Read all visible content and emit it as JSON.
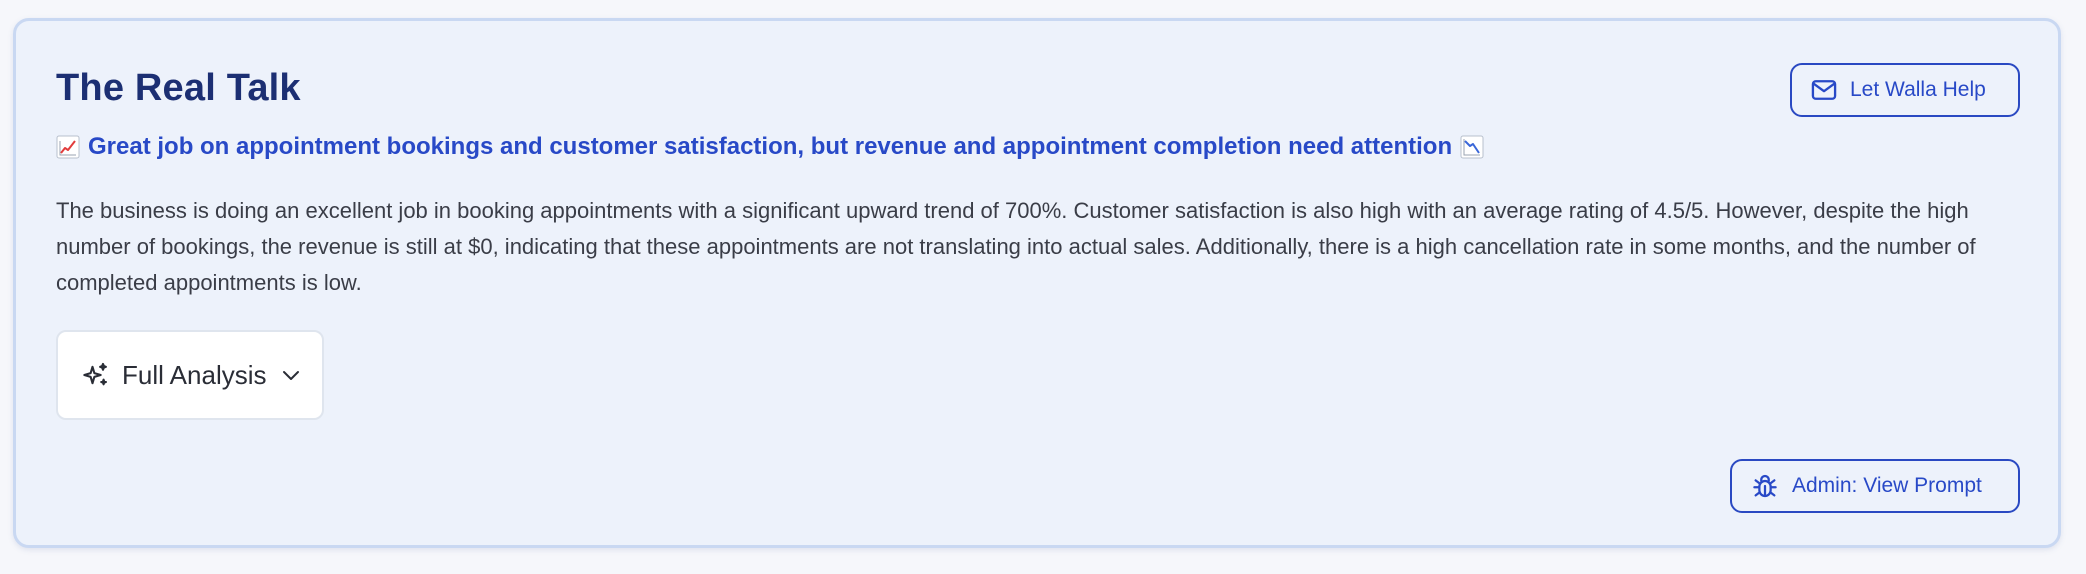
{
  "card": {
    "title": "The Real Talk",
    "headline": "Great job on appointment bookings and customer satisfaction, but revenue and appointment completion need attention",
    "headline_icon_left": "chart-increasing-icon",
    "headline_icon_right": "chart-decreasing-icon",
    "body": "The business is doing an excellent job in booking appointments with a significant upward trend of 700%. Customer satisfaction is also high with an average rating of 4.5/5. However, despite the high number of bookings, the revenue is still at $0, indicating that these appointments are not translating into actual sales. Additionally, there is a high cancellation rate in some months, and the number of completed appointments is low."
  },
  "buttons": {
    "help_label": "Let Walla Help",
    "help_icon": "mail-icon",
    "analysis_label": "Full Analysis",
    "analysis_icon": "sparkles-icon",
    "analysis_chevron": "chevron-down-icon",
    "admin_label": "Admin: View Prompt",
    "admin_icon": "bug-icon"
  },
  "colors": {
    "title": "#1c2f73",
    "accent": "#2849c7",
    "card_background": "#edf2fb",
    "card_border": "#c9d8f2",
    "body_text": "#3a3d47"
  }
}
